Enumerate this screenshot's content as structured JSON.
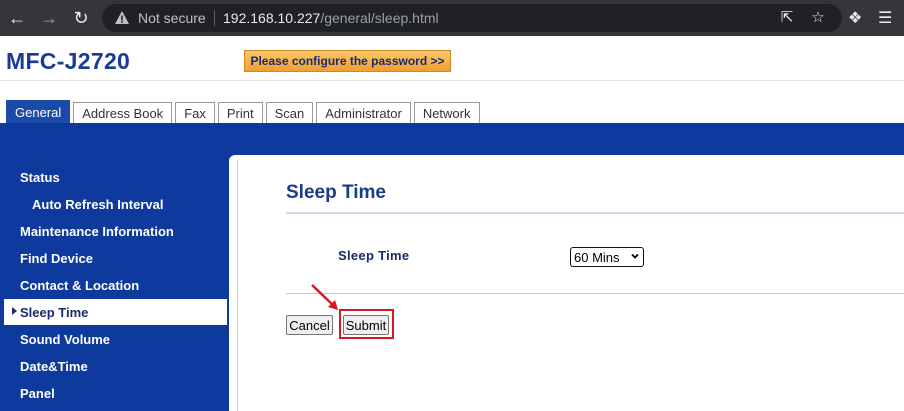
{
  "browser": {
    "security_label": "Not secure",
    "url_host": "192.168.10.227",
    "url_path": "/general/sleep.html"
  },
  "header": {
    "model": "MFC-J2720",
    "password_button": "Please configure the password >>"
  },
  "tabs": [
    {
      "label": "General",
      "active": true
    },
    {
      "label": "Address Book"
    },
    {
      "label": "Fax"
    },
    {
      "label": "Print"
    },
    {
      "label": "Scan"
    },
    {
      "label": "Administrator"
    },
    {
      "label": "Network"
    }
  ],
  "sidebar": {
    "items": [
      {
        "label": "Status"
      },
      {
        "label": "Auto Refresh Interval"
      },
      {
        "label": "Maintenance Information"
      },
      {
        "label": "Find Device"
      },
      {
        "label": "Contact & Location"
      },
      {
        "label": "Sleep Time",
        "active": true
      },
      {
        "label": "Sound Volume"
      },
      {
        "label": "Date&Time"
      },
      {
        "label": "Panel"
      }
    ]
  },
  "main": {
    "title": "Sleep Time",
    "field_label": "Sleep Time",
    "select_value": "60 Mins",
    "cancel_label": "Cancel",
    "submit_label": "Submit"
  },
  "colors": {
    "brand_blue": "#0d3a9c",
    "highlight_red": "#d9191f",
    "password_orange": "#f0a030"
  }
}
